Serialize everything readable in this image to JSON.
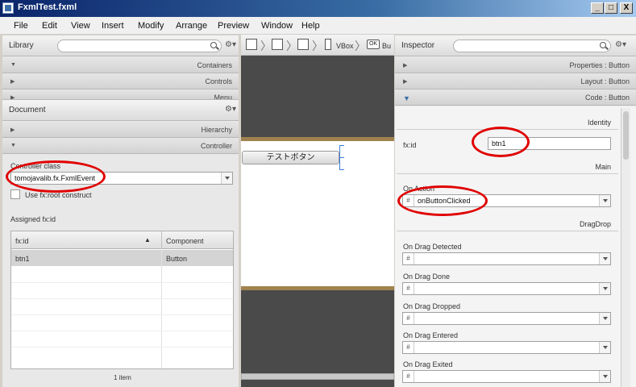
{
  "window": {
    "title": "FxmlTest.fxml",
    "buttons": [
      "_",
      "□",
      "X"
    ]
  },
  "menu": [
    "File",
    "Edit",
    "View",
    "Insert",
    "Modify",
    "Arrange",
    "Preview",
    "Window",
    "Help"
  ],
  "library": {
    "title": "Library",
    "rows": [
      "Containers",
      "Controls",
      "Menu"
    ]
  },
  "document": {
    "title": "Document",
    "rows": [
      "Hierarchy",
      "Controller"
    ],
    "controller_class_label": "Controller class",
    "controller_class_value": "tomojavalib.fx.FxmlEvent",
    "use_fxroot_label": "Use fx:root construct",
    "assigned_fxid_label": "Assigned fx:id",
    "table": {
      "columns": [
        "fx:id",
        "Component"
      ],
      "rows": [
        [
          "btn1",
          "Button"
        ]
      ]
    },
    "footer": "1 item"
  },
  "breadcrumb": {
    "items": [
      "VBox",
      "Bu"
    ]
  },
  "canvas": {
    "button_label": "テストボタン"
  },
  "inspector": {
    "title": "Inspector",
    "rows": [
      {
        "label": "Properties : Button",
        "expanded": false
      },
      {
        "label": "Layout : Button",
        "expanded": false
      },
      {
        "label": "Code : Button",
        "expanded": true
      }
    ],
    "sections": {
      "identity": "Identity",
      "main": "Main",
      "dragdrop": "DragDrop"
    },
    "fxid_label": "fx:id",
    "fxid_value": "btn1",
    "on_action_label": "On Action",
    "on_action_value": "onButtonClicked",
    "hash": "#",
    "drag_events": [
      "On Drag Detected",
      "On Drag Done",
      "On Drag Dropped",
      "On Drag Entered",
      "On Drag Exited"
    ]
  },
  "colors": {
    "annotation": "#e00000",
    "canvas_bg": "#4a4a4a",
    "frame_bar": "#a0824e"
  }
}
